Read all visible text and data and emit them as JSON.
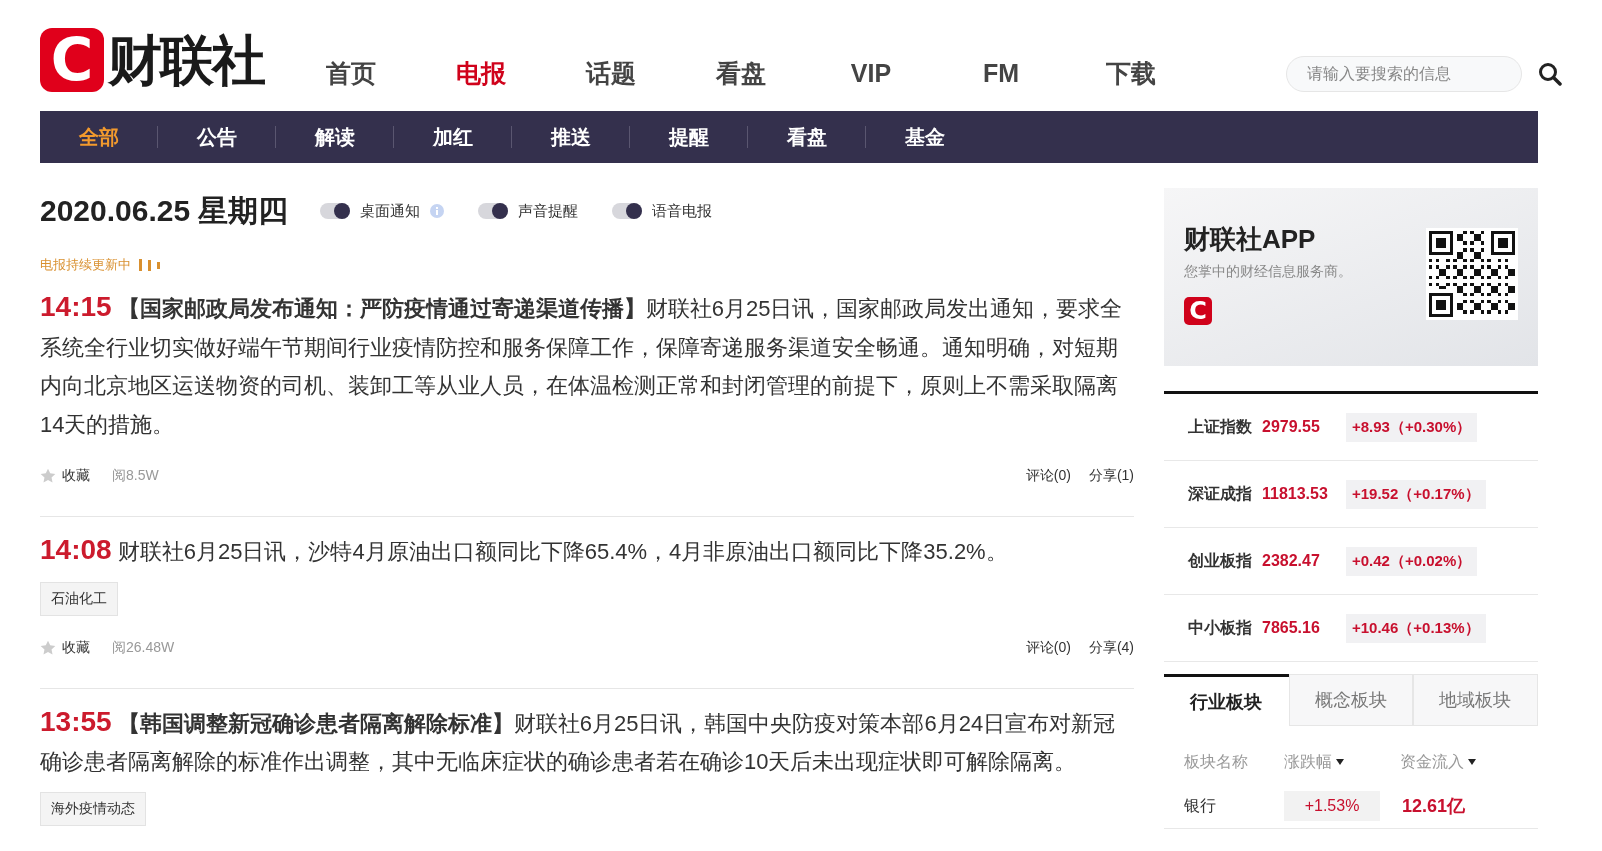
{
  "logo": {
    "mark": "C",
    "name": "财联社"
  },
  "nav": [
    {
      "label": "首页",
      "selected": false
    },
    {
      "label": "电报",
      "selected": true
    },
    {
      "label": "话题",
      "selected": false
    },
    {
      "label": "看盘",
      "selected": false
    },
    {
      "label": "VIP",
      "selected": false
    },
    {
      "label": "FM",
      "selected": false
    },
    {
      "label": "下载",
      "selected": false
    }
  ],
  "search": {
    "placeholder": "请输入要搜索的信息"
  },
  "subnav": [
    {
      "label": "全部",
      "selected": true
    },
    {
      "label": "公告",
      "selected": false
    },
    {
      "label": "解读",
      "selected": false
    },
    {
      "label": "加红",
      "selected": false
    },
    {
      "label": "推送",
      "selected": false
    },
    {
      "label": "提醒",
      "selected": false
    },
    {
      "label": "看盘",
      "selected": false
    },
    {
      "label": "基金",
      "selected": false
    }
  ],
  "date": "2020.06.25 星期四",
  "toggles": [
    {
      "label": "桌面通知",
      "on": true,
      "info": true
    },
    {
      "label": "声音提醒",
      "on": true,
      "info": false
    },
    {
      "label": "语音电报",
      "on": true,
      "info": false
    }
  ],
  "live_status": "电报持续更新中",
  "news": [
    {
      "time": "14:15",
      "text": "**【国家邮政局发布通知：严防疫情通过寄递渠道传播】**财联社6月25日讯，国家邮政局发出通知，要求全系统全行业切实做好端午节期间行业疫情防控和服务保障工作，保障寄递服务渠道安全畅通。通知明确，对短期内向北京地区运送物资的司机、装卸工等从业人员，在体温检测正常和封闭管理的前提下，原则上不需采取隔离14天的措施。",
      "footer": {
        "favorite": "收藏",
        "reads": "阅8.5W",
        "comments": "评论(0)",
        "shares": "分享(1)"
      }
    },
    {
      "time": "14:08",
      "text": "财联社6月25日讯，沙特4月原油出口额同比下降65.4%，4月非原油出口额同比下降35.2%。",
      "tags": [
        "石油化工"
      ],
      "footer": {
        "favorite": "收藏",
        "reads": "阅26.48W",
        "comments": "评论(0)",
        "shares": "分享(4)"
      }
    },
    {
      "time": "13:55",
      "text": "**【韩国调整新冠确诊患者隔离解除标准】**财联社6月25日讯，韩国中央防疫对策本部6月24日宣布对新冠确诊患者隔离解除的标准作出调整，其中无临床症状的确诊患者若在确诊10天后未出现症状即可解除隔离。",
      "tags": [
        "海外疫情动态"
      ]
    }
  ],
  "app_card": {
    "title": "财联社APP",
    "subtitle": "您掌中的财经信息服务商。",
    "mark": "C"
  },
  "indices": [
    {
      "name": "上证指数",
      "value": "2979.55",
      "change": "+8.93（+0.30%）"
    },
    {
      "name": "深证成指",
      "value": "11813.53",
      "change": "+19.52（+0.17%）"
    },
    {
      "name": "创业板指",
      "value": "2382.47",
      "change": "+0.42（+0.02%）"
    },
    {
      "name": "中小板指",
      "value": "7865.16",
      "change": "+10.46（+0.13%）"
    }
  ],
  "sector_tabs": [
    {
      "label": "行业板块",
      "selected": true
    },
    {
      "label": "概念板块",
      "selected": false
    },
    {
      "label": "地域板块",
      "selected": false
    }
  ],
  "sector_table": {
    "columns": [
      {
        "label": "板块名称",
        "sortable": false
      },
      {
        "label": "涨跌幅",
        "sortable": true
      },
      {
        "label": "资金流入",
        "sortable": true
      }
    ],
    "rows": [
      [
        "银行",
        "+1.53%",
        "12.61亿"
      ]
    ]
  }
}
